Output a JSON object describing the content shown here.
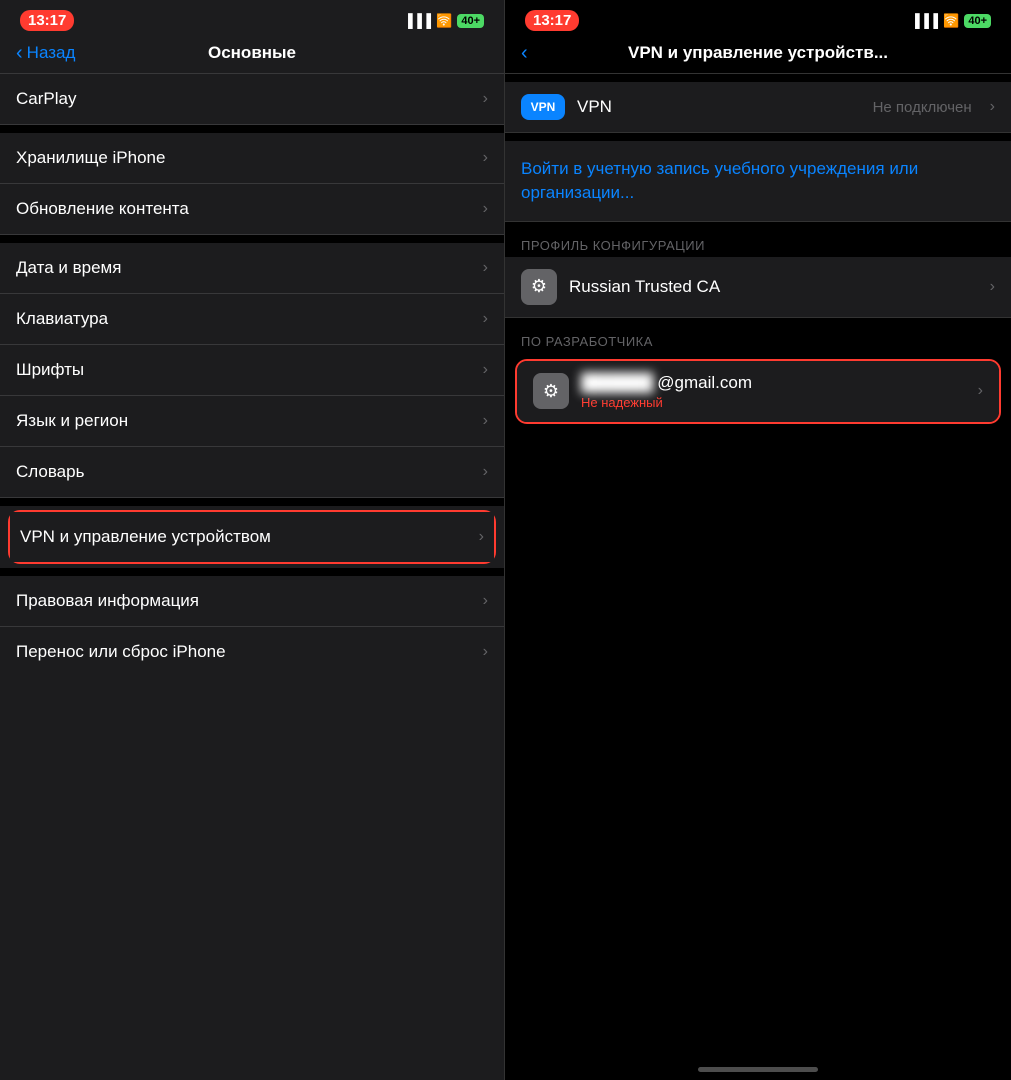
{
  "left": {
    "status": {
      "time": "13:17",
      "battery": "40+"
    },
    "nav": {
      "back_label": "Назад",
      "title": "Основные"
    },
    "items": [
      {
        "label": "CarPlay"
      },
      {
        "label": "Хранилище iPhone"
      },
      {
        "label": "Обновление контента"
      },
      {
        "label": "Дата и время"
      },
      {
        "label": "Клавиатура"
      },
      {
        "label": "Шрифты"
      },
      {
        "label": "Язык и регион"
      },
      {
        "label": "Словарь"
      },
      {
        "label": "VPN и управление устройством",
        "highlighted": true
      },
      {
        "label": "Правовая информация"
      },
      {
        "label": "Перенос или сброс iPhone"
      }
    ]
  },
  "right": {
    "status": {
      "time": "13:17",
      "battery": "40+"
    },
    "nav": {
      "back_icon": "‹",
      "title": "VPN и управление устройств..."
    },
    "vpn": {
      "badge": "VPN",
      "label": "VPN",
      "status": "Не подключен"
    },
    "school_link": "Войти в учетную запись учебного учреждения или организации...",
    "section_profile": "ПРОФИЛЬ КОНФИГУРАЦИИ",
    "profile_russian_ca": {
      "name": "Russian Trusted CA"
    },
    "section_developer": "ПО РАЗРАБОТЧИКА",
    "profile_gmail": {
      "name": "@gmail.com",
      "subtitle": "Не надежный",
      "blurred": "████████"
    }
  },
  "icons": {
    "chevron_right": "›",
    "chevron_left": "‹",
    "gear": "⚙"
  }
}
